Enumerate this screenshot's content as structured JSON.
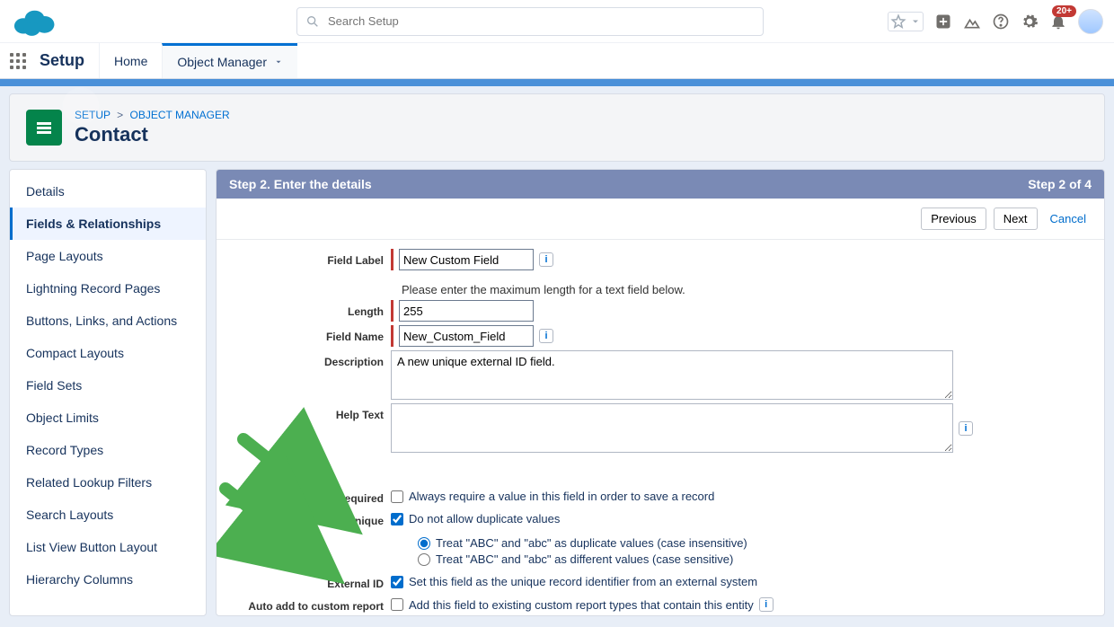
{
  "header": {
    "search_placeholder": "Search Setup",
    "notification_badge": "20+"
  },
  "context_bar": {
    "app_name": "Setup",
    "tabs": {
      "home": "Home",
      "object_manager": "Object Manager"
    }
  },
  "page_header": {
    "breadcrumb_setup": "SETUP",
    "breadcrumb_object_manager": "OBJECT MANAGER",
    "title": "Contact"
  },
  "sidebar": {
    "items": [
      "Details",
      "Fields & Relationships",
      "Page Layouts",
      "Lightning Record Pages",
      "Buttons, Links, and Actions",
      "Compact Layouts",
      "Field Sets",
      "Object Limits",
      "Record Types",
      "Related Lookup Filters",
      "Search Layouts",
      "List View Button Layout",
      "Hierarchy Columns"
    ],
    "active_index": 1
  },
  "step_banner": {
    "title": "Step 2. Enter the details",
    "counter": "Step 2 of 4"
  },
  "actions": {
    "previous": "Previous",
    "next": "Next",
    "cancel": "Cancel"
  },
  "form": {
    "labels": {
      "field_label": "Field Label",
      "length": "Length",
      "field_name": "Field Name",
      "description": "Description",
      "help_text": "Help Text",
      "required": "Required",
      "unique": "Unique",
      "external_id": "External ID",
      "auto_add": "Auto add to custom report type"
    },
    "values": {
      "field_label": "New Custom Field",
      "length": "255",
      "field_name": "New_Custom_Field",
      "description": "A new unique external ID field.",
      "help_text": ""
    },
    "hint_length": "Please enter the maximum length for a text field below.",
    "checkboxes": {
      "required_text": "Always require a value in this field in order to save a record",
      "unique_text": "Do not allow duplicate values",
      "unique_case_insensitive": "Treat \"ABC\" and \"abc\" as duplicate values (case insensitive)",
      "unique_case_sensitive": "Treat \"ABC\" and \"abc\" as different values (case sensitive)",
      "external_id_text": "Set this field as the unique record identifier from an external system",
      "auto_add_text": "Add this field to existing custom report types that contain this entity"
    }
  }
}
